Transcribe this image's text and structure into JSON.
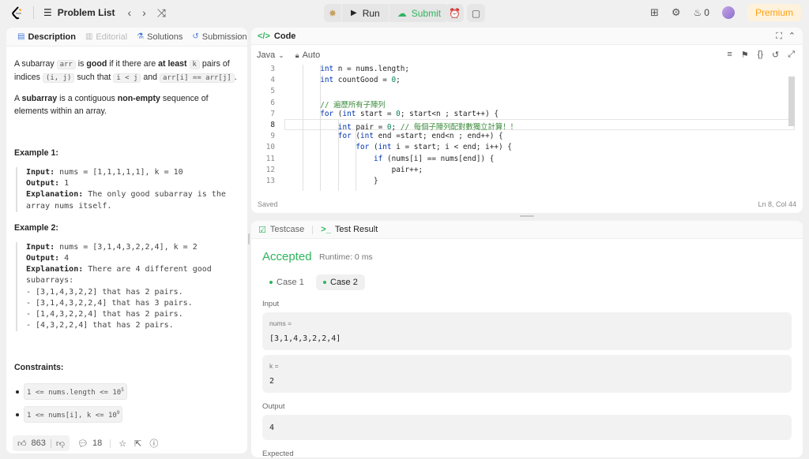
{
  "topbar": {
    "problem_list_label": "Problem List",
    "run_label": "Run",
    "submit_label": "Submit",
    "streak_count": "0",
    "premium_label": "Premium"
  },
  "left": {
    "tabs": [
      {
        "label": "Description"
      },
      {
        "label": "Editorial"
      },
      {
        "label": "Solutions"
      },
      {
        "label": "Submissions"
      }
    ],
    "intro": {
      "p1_a": "A subarray ",
      "p1_code1": "arr",
      "p1_b": " is ",
      "p1_good": "good",
      "p1_c": " if it there are ",
      "p1_atleast": "at least",
      "p1_d": " ",
      "p1_code2": "k",
      "p1_e": " pairs of",
      "p1_f": "indices ",
      "p1_code3": "(i, j)",
      "p1_g": " such that ",
      "p1_code4": "i < j",
      "p1_h": " and ",
      "p1_code5": "arr[i] == arr[j]",
      "p1_i": ".",
      "p2_a": "A ",
      "p2_sub": "subarray",
      "p2_b": " is a contiguous ",
      "p2_ne": "non-empty",
      "p2_c": " sequence of",
      "p2_d": "elements within an array."
    },
    "example1": {
      "title": "Example 1:",
      "input_label": "Input:",
      "input": " nums = [1,1,1,1,1], k = 10",
      "output_label": "Output:",
      "output": " 1",
      "explanation_label": "Explanation:",
      "explanation_1": " The only good subarray is the",
      "explanation_2": "array nums itself."
    },
    "example2": {
      "title": "Example 2:",
      "input_label": "Input:",
      "input": " nums = [3,1,4,3,2,2,4], k = 2",
      "output_label": "Output:",
      "output": " 4",
      "explanation_label": "Explanation:",
      "explanation_1": " There are 4 different good",
      "lines": [
        "subarrays:",
        "- [3,1,4,3,2,2] that has 2 pairs.",
        "- [3,1,4,3,2,2,4] that has 3 pairs.",
        "- [1,4,3,2,2,4] that has 2 pairs.",
        "- [4,3,2,2,4] that has 2 pairs."
      ]
    },
    "constraints": {
      "title": "Constraints:",
      "c1_base": "1 <= nums.length <= 10",
      "c1_exp": "5",
      "c2_base": "1 <= nums[i], k <= 10",
      "c2_exp": "9"
    },
    "footer": {
      "likes": "863",
      "comments": "18"
    }
  },
  "code": {
    "title": "Code",
    "language": "Java",
    "mode": "Auto",
    "lines": [
      {
        "n": "3",
        "indent": 2,
        "text": "int n = nums.length;"
      },
      {
        "n": "4",
        "indent": 2,
        "text": "int countGood = 0;"
      },
      {
        "n": "5",
        "indent": 0,
        "text": ""
      },
      {
        "n": "6",
        "indent": 2,
        "text": "// 遍歷所有子陣列"
      },
      {
        "n": "7",
        "indent": 2,
        "text": "for (int start = 0; start<n ; start++) {"
      },
      {
        "n": "8",
        "indent": 3,
        "text": "int pair = 0; // 每個子陣列配對數獨立計算！！"
      },
      {
        "n": "9",
        "indent": 3,
        "text": "for (int end =start; end<n ; end++) {"
      },
      {
        "n": "10",
        "indent": 4,
        "text": "for (int i = start; i < end; i++) {"
      },
      {
        "n": "11",
        "indent": 5,
        "text": "if (nums[i] == nums[end]) {"
      },
      {
        "n": "12",
        "indent": 6,
        "text": "pair++;"
      },
      {
        "n": "13",
        "indent": 5,
        "text": "}"
      }
    ],
    "status": "Saved",
    "cursor": "Ln 8, Col 44"
  },
  "result": {
    "testcase_tab": "Testcase",
    "result_tab": "Test Result",
    "verdict": "Accepted",
    "runtime": "Runtime: 0 ms",
    "cases": [
      "Case 1",
      "Case 2"
    ],
    "input_label": "Input",
    "nums_key": "nums =",
    "nums_value": "[3,1,4,3,2,2,4]",
    "k_key": "k =",
    "k_value": "2",
    "output_label": "Output",
    "output_value": "4",
    "expected_label": "Expected"
  },
  "colors": {
    "accent_green": "#2db55d",
    "premium_orange": "#ffa116",
    "keyword_blue": "#0033b3",
    "comment_green": "#3a8a3a"
  }
}
